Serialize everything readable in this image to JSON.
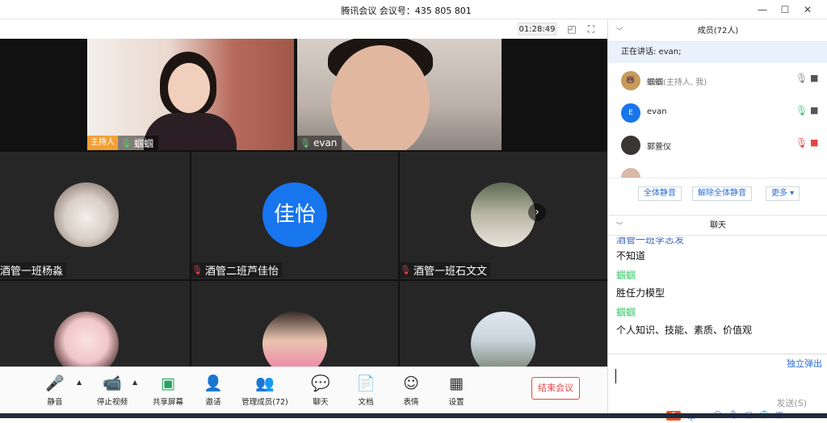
{
  "window": {
    "title": "腾讯会议 会议号：435 805 801",
    "minimize_icon": "minimize-icon",
    "maximize_icon": "maximize-icon",
    "close_icon": "close-icon"
  },
  "video": {
    "timer": "01:28:49",
    "layout_icon": "layout-icon",
    "fullscreen_icon": "fullscreen-icon",
    "speakers": [
      {
        "host_tag": "主持人",
        "name": "蝈蝈"
      },
      {
        "name": "evan"
      }
    ],
    "grid": [
      {
        "name": "酒管一班杨淼"
      },
      {
        "name": "酒管二班芦佳怡",
        "avatar_text": "佳怡"
      },
      {
        "name": "酒管一班石文文"
      }
    ]
  },
  "toolbar": {
    "items": [
      {
        "label": "静音",
        "icon": "microphone-icon"
      },
      {
        "label": "停止视频",
        "icon": "camera-icon"
      },
      {
        "label": "共享屏幕",
        "icon": "share-screen-icon"
      },
      {
        "label": "邀请",
        "icon": "invite-icon"
      },
      {
        "label": "管理成员(72)",
        "icon": "members-icon"
      },
      {
        "label": "聊天",
        "icon": "chat-icon"
      },
      {
        "label": "文档",
        "icon": "document-icon"
      },
      {
        "label": "表情",
        "icon": "emoji-icon"
      },
      {
        "label": "设置",
        "icon": "settings-icon"
      }
    ],
    "end_label": "结束会议"
  },
  "members": {
    "header": "成员(72人)",
    "speaking": "正在讲话: evan;",
    "list": [
      {
        "name": "蝈蝈",
        "sub": "(主持人, 我)"
      },
      {
        "name": "evan",
        "initial": "E"
      },
      {
        "name": "郭萱仪"
      }
    ],
    "actions": [
      "全体静音",
      "解除全体静音",
      "更多 ▾"
    ]
  },
  "chat": {
    "header": "聊天",
    "partial_sender": "酒管一班李志发",
    "messages": [
      {
        "text": "不知道"
      },
      {
        "sender": "蝈蝈",
        "text": "胜任力模型"
      },
      {
        "sender": "蝈蝈",
        "text": "个人知识、技能、素质、价值观"
      }
    ],
    "popout": "独立弹出",
    "send": "发送(S)"
  },
  "ime": {
    "logo": "S",
    "mode": "中"
  },
  "colors": {
    "accent": "#2a6fd6",
    "end_red": "#e54848",
    "host_orange": "#f2a036",
    "sender_green": "#3cc76d",
    "mic_green": "#4cd964"
  }
}
